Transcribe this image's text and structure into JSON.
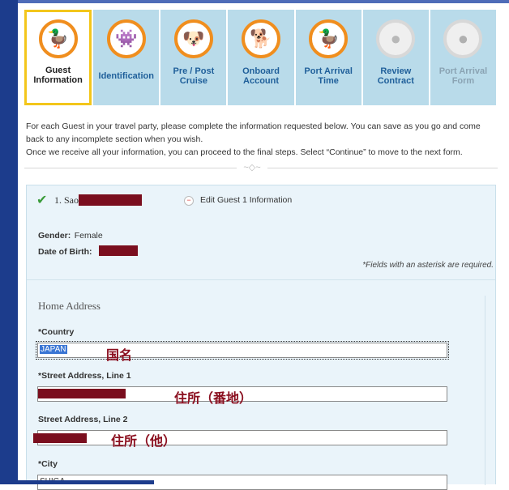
{
  "steps": [
    {
      "label_line1": "Guest",
      "label_line2": "Information",
      "icon": "donald-duck-icon",
      "glyph": "🦆"
    },
    {
      "label_line1": "Identification",
      "label_line2": "",
      "icon": "stitch-icon",
      "glyph": "👾"
    },
    {
      "label_line1": "Pre / Post",
      "label_line2": "Cruise",
      "icon": "pluto-icon",
      "glyph": "🐶"
    },
    {
      "label_line1": "Onboard",
      "label_line2": "Account",
      "icon": "goofy-icon",
      "glyph": "🐕"
    },
    {
      "label_line1": "Port Arrival",
      "label_line2": "Time",
      "icon": "daisy-duck-icon",
      "glyph": "🦆"
    },
    {
      "label_line1": "Review",
      "label_line2": "Contract",
      "icon": "locked-character-icon",
      "glyph": "●"
    },
    {
      "label_line1": "Port Arrival",
      "label_line2": "Form",
      "icon": "locked-character-icon",
      "glyph": "●"
    }
  ],
  "intro": {
    "line1": "For each Guest in your travel party, please complete the information requested below. You can save as you go and come",
    "line2": "back to any incomplete section when you wish.",
    "line3": "Once we receive all your information, you can proceed to the final steps. Select “Continue” to move to the next form."
  },
  "guest": {
    "name_prefix": "1. Sao",
    "edit_label": "Edit Guest 1 Information",
    "gender_label": "Gender:",
    "gender_value": "Female",
    "dob_label": "Date of Birth:"
  },
  "required_note": "*Fields with an asterisk are required.",
  "address": {
    "section_title": "Home Address",
    "country_label": "*Country",
    "country_value": "JAPAN",
    "country_annotation": "国名",
    "street1_label": "*Street Address, Line 1",
    "street1_annotation": "住所（番地）",
    "street2_label": "Street Address, Line 2",
    "street2_annotation": "住所（他）",
    "city_label": "*City",
    "city_value": "SHIGA"
  },
  "colors": {
    "step_bg": "#b9dbea",
    "active_border": "#f3c61b",
    "badge_ring": "#f08e1e",
    "panel_bg": "#eaf4fa",
    "redaction": "#7a0e1e",
    "annotation": "#8b1020"
  }
}
